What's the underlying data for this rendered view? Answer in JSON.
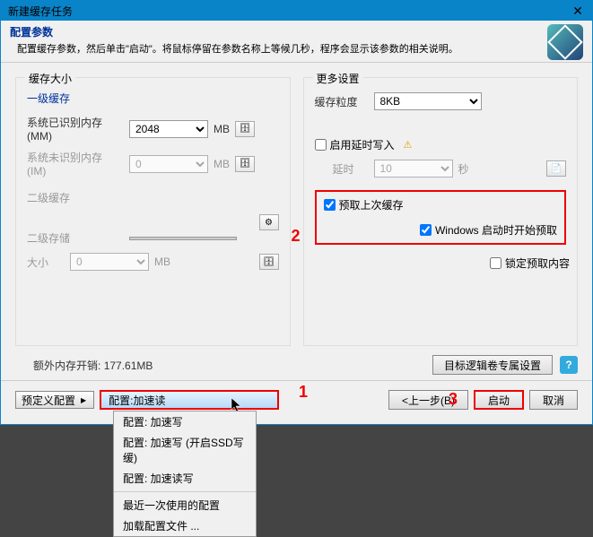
{
  "titlebar": {
    "title": "新建缓存任务",
    "close": "✕"
  },
  "header": {
    "title": "配置参数",
    "desc": "配置缓存参数，然后单击\"启动\"。将鼠标停留在参数名称上等候几秒，程序会显示该参数的相关说明。"
  },
  "left": {
    "panel_title": "缓存大小",
    "l1": {
      "title": "一级缓存",
      "recognized_label": "系统已识别内存 (MM)",
      "recognized_value": "2048",
      "recognized_unit": "MB",
      "unrecognized_label": "系统未识别内存 (IM)",
      "unrecognized_value": "0",
      "unrecognized_unit": "MB"
    },
    "l2": {
      "title": "二级缓存",
      "storage_label": "二级存储",
      "size_label": "大小",
      "size_value": "0",
      "size_unit": "MB"
    }
  },
  "right": {
    "panel_title": "更多设置",
    "granularity_label": "缓存粒度",
    "granularity_value": "8KB",
    "defer_write_label": "启用延时写入",
    "delay_label": "延时",
    "delay_value": "10",
    "delay_unit": "秒",
    "prefetch_label": "预取上次缓存",
    "prefetch_boot_label": "Windows 启动时开始预取",
    "lock_label": "锁定预取内容"
  },
  "extra_label": "额外内存开销:",
  "extra_value": "177.61MB",
  "target_btn": "目标逻辑卷专属设置",
  "help": "?",
  "preset_btn": "预定义配置",
  "config_prefix": "配置: ",
  "config_value": "加速读",
  "menu": {
    "item1": "配置: 加速写",
    "item2": "配置: 加速写 (开启SSD写缓)",
    "item3": "配置: 加速读写",
    "recent": "最近一次使用的配置",
    "load": "加载配置文件 ..."
  },
  "buttons": {
    "prev": "<上一步(B)",
    "start": "启动",
    "cancel": "取消"
  },
  "anno": {
    "one": "1",
    "two": "2",
    "three": "3"
  }
}
